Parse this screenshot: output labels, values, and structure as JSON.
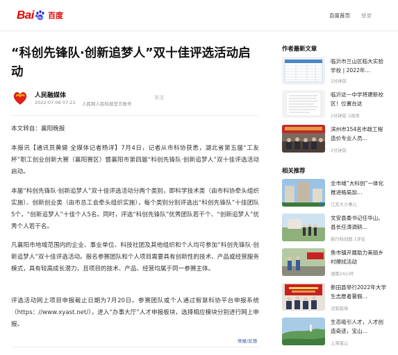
{
  "header": {
    "logo_bai": "Bai",
    "logo_du": "du",
    "logo_cn": "百度",
    "home_link": "百度首页",
    "login_link": "登录"
  },
  "article": {
    "title": "“科创先锋队·创新追梦人”双十佳评选活动启动",
    "author_name": "人民融媒体",
    "date": "2022-07-06 07:22",
    "author_desc": "人民网人民科技官方账号",
    "follow": "关注",
    "paragraphs": [
      "本文转自：襄阳晚报",
      "本报讯【通讯员黄健 全媒体记者杨洋】7月4日，记者从市科协获悉，湖北省第五届“工友杯”职工创业创新大赛（襄阳赛区）暨襄阳市第四届“科创先锋队·创新追梦人”双十佳评选活动启动。",
      "本届“科创先锋队·创新追梦人”双十佳评选活动分两个类别，即科学技术类（由市科协牵头组织实施）、创新创业类（由市总工会牵头组织实施），每个类别分别评选出“科创先锋队”十佳团队5个，“创新追梦人”十佳个人5名。同时，评选“科创先锋队”优秀团队若干个、“创新追梦人”优秀个人若干名。",
      "凡襄阳市地域范围内的企业、事业单位、科技社团及其他组织和个人均可参加“科创先锋队·创新追梦人”双十佳评选活动。报名参赛团队和个人项目需要具有创新性的技术、产品或经营服务模式，具有较高成长潜力，且项目的技术、产品、经营均属于同一参赛主体。",
      "评选活动网上项目申报截止日期为7月20日。参赛团队或个人通过智慧科协平台申报系统（https：//www.xyast.net/），进入“办事大厅”人才申报板块，选择相应模块分别进行网上申报。"
    ],
    "report_link": "举报/反馈"
  },
  "sidebar": {
    "latest_title": "作者最新文章",
    "latest": [
      {
        "title": "临沂市兰山区临大实验学校 | 2022年…",
        "meta": "2分钟前",
        "thumb": "table"
      },
      {
        "title": "临沂这一中学将建新校区！位置在这",
        "meta": "2分钟前  1阅读",
        "thumb": "doc"
      },
      {
        "title": "滨州市154名市政工程造价专业人员…",
        "meta": "2分钟前",
        "thumb": "meeting"
      }
    ],
    "related_title": "相关推荐",
    "related": [
      {
        "title": "全市域“大科创”一体化推进格局加…",
        "meta": "江苏大小事儿",
        "thumb": "building"
      },
      {
        "title": "文安县委书记任华山、县长任涛调研…",
        "meta": "新行科创园  1评论",
        "thumb": "outdoor"
      },
      {
        "title": "鱼市镇开展助力美丽乡村擦拭活动",
        "meta": "湖南24小时",
        "thumb": "people"
      },
      {
        "title": "新田县举行2022年大学生志愿者暑假…",
        "meta": "法制现场",
        "thumb": "stage"
      },
      {
        "title": "生态吸引人才，人才创造奇迹，宝山…",
        "meta": "上海宝山",
        "thumb": "landscape"
      }
    ]
  }
}
